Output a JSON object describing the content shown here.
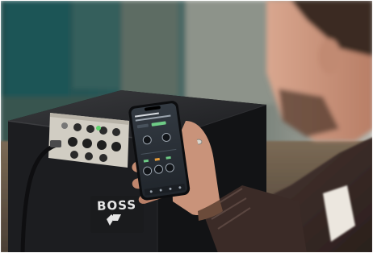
{
  "image": {
    "brand_logo_text": "BOSS"
  },
  "colors": {
    "wall_teal": "#2c5a5a",
    "amp_black": "#191a1c",
    "amp_panel_metal": "#cfcbc2",
    "phone_screen_dark": "#2a2f36",
    "phone_accent_green": "#6ecb86",
    "sweater_brown": "#3b2b27",
    "skin": "#c9937a"
  }
}
